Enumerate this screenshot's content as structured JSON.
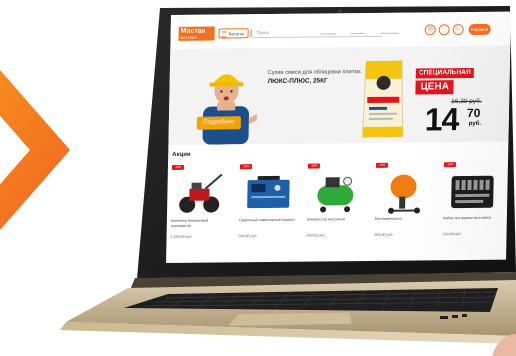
{
  "header": {
    "logo_name": "Мастак",
    "logo_tagline": "МАГАЗИН",
    "catalog_label": "Каталог",
    "search_placeholder": "Поиск",
    "icons": [
      "location-icon",
      "heart-icon",
      "user-icon"
    ],
    "cart_label": "Корзина"
  },
  "banner": {
    "intro_text": "Сухие смеси для облицовки плитки:",
    "product_name": "ЛЮКС-ПЛЮС, 25КГ",
    "more_button": "Подробнее",
    "promo_line1": "СПЕЦИАЛЬНАЯ",
    "promo_line2": "ЦЕНА",
    "old_price": "16,39 руб.",
    "price_int": "14",
    "price_frac": "70",
    "price_unit": "руб."
  },
  "section": {
    "title": "Акции"
  },
  "products": [
    {
      "badge": "-10%",
      "title": "Мотоблок бензиновый культиватор",
      "price": "1 699,00 руб."
    },
    {
      "badge": "-10%",
      "title": "Сварочный инверторный аппарат",
      "price": "599,00 руб."
    },
    {
      "badge": "-10%",
      "title": "Компрессор масляный",
      "price": "499,00 руб."
    },
    {
      "badge": "-10%",
      "title": "Бетономешалка",
      "price": "899,00 руб."
    },
    {
      "badge": "-10%",
      "title": "Набор инструментов в кейсе",
      "price": "199,00 руб."
    }
  ],
  "colors": {
    "brand_orange": "#f37021",
    "accent_red": "#e3141b",
    "laptop_body": "#c7b48e"
  }
}
